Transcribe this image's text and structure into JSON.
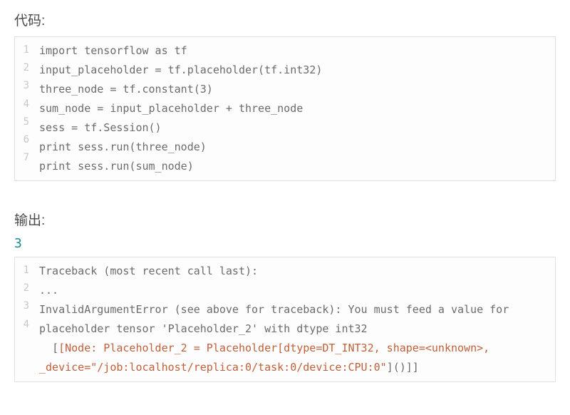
{
  "labels": {
    "code": "代码:",
    "output": "输出:"
  },
  "code_block": {
    "lines": [
      "import tensorflow as tf",
      "input_placeholder = tf.placeholder(tf.int32)",
      "three_node = tf.constant(3)",
      "sum_node = input_placeholder + three_node",
      "sess = tf.Session()",
      "print sess.run(three_node)",
      "print sess.run(sum_node)"
    ]
  },
  "output_value": "3",
  "traceback_block": {
    "lines": [
      {
        "n": "1",
        "segments": [
          {
            "text": "Traceback (most recent call last):"
          }
        ]
      },
      {
        "n": "2",
        "segments": [
          {
            "text": "..."
          }
        ]
      },
      {
        "n": "3",
        "segments": [
          {
            "text": "InvalidArgumentError (see above for traceback): You must feed a value for placeholder tensor 'Placeholder_2' with dtype int32"
          }
        ]
      },
      {
        "n": "4",
        "segments": [
          {
            "text": "  ["
          },
          {
            "text": "[Node: Placeholder_2 = Placeholder[dtype=DT_INT32, shape=<unknown>, _device=\"/job:localhost/replica:0/task:0/device:CPU:0\"",
            "link": true
          },
          {
            "text": "]()]]"
          }
        ]
      }
    ]
  }
}
